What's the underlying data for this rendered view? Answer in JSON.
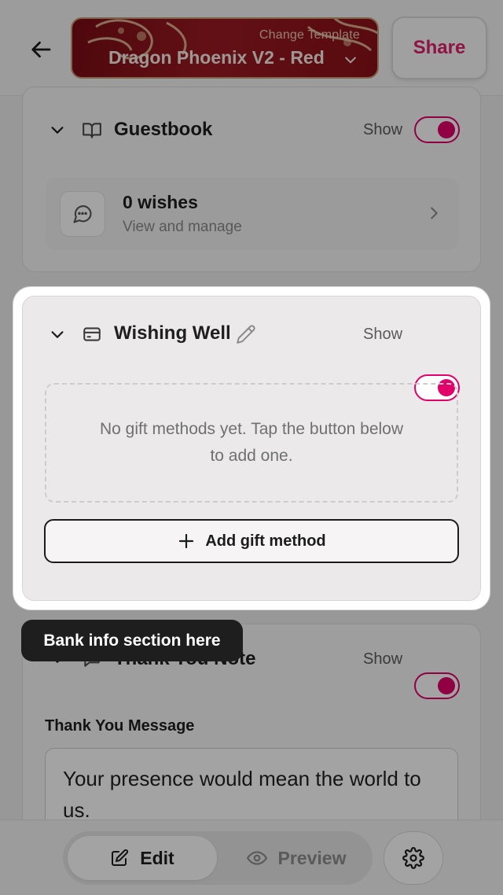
{
  "header": {
    "template_hint": "Change Template",
    "template_name": "Dragon Phoenix V2 - Red",
    "share_label": "Share"
  },
  "guestbook": {
    "title": "Guestbook",
    "show_label": "Show",
    "enabled": true,
    "wishes_count": "0 wishes",
    "wishes_sub": "View and manage"
  },
  "wishing_well": {
    "title": "Wishing Well",
    "show_label": "Show",
    "enabled": true,
    "empty_text": "No gift methods yet. Tap the button below to add one.",
    "add_button": "Add gift method"
  },
  "tooltip": {
    "text": "Bank info section here"
  },
  "thank_you": {
    "title": "Thank You Note",
    "show_label": "Show",
    "enabled": true,
    "field_label": "Thank You Message",
    "message": "Your presence would mean the world to us."
  },
  "bottom_nav": {
    "edit_label": "Edit",
    "preview_label": "Preview"
  },
  "colors": {
    "accent": "#e2006a",
    "template_bg": "#8a1118"
  },
  "icons": {
    "back": "arrow-left-icon",
    "template_dropdown": "chevron-down-icon",
    "guestbook": "book-open-icon",
    "wishes": "message-circle-icon",
    "wishing_well": "credit-card-icon",
    "edit_title": "pencil-icon",
    "thank_you": "heart-message-icon",
    "add": "plus-icon",
    "edit": "edit-square-icon",
    "preview": "eye-icon",
    "settings": "gear-icon"
  }
}
